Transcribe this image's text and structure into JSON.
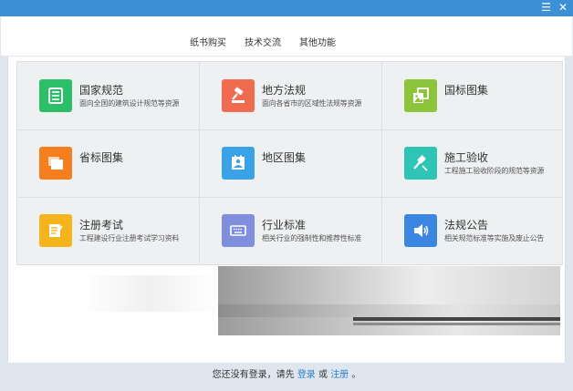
{
  "window": {
    "controls": {
      "menu_icon": "menu-icon",
      "close_icon": "close-icon"
    }
  },
  "topnav": {
    "links": [
      "纸书购买",
      "技术交流",
      "其他功能"
    ]
  },
  "tiles": [
    {
      "title": "国家规范",
      "desc": "面向全国的建筑设计规范等资源",
      "icon": "document-icon",
      "color": "#2bbf6a"
    },
    {
      "title": "地方法规",
      "desc": "面向各省市的区域性法规等资源",
      "icon": "gavel-icon",
      "color": "#f06b4f"
    },
    {
      "title": "国标图集",
      "desc": "",
      "icon": "image-icon",
      "color": "#8cc43c"
    },
    {
      "title": "省标图集",
      "desc": "",
      "icon": "stack-icon",
      "color": "#f57e1f"
    },
    {
      "title": "地区图集",
      "desc": "",
      "icon": "map-photo-icon",
      "color": "#3aa3e8"
    },
    {
      "title": "施工验收",
      "desc": "工程施工验收阶段的规范等资源",
      "icon": "hammer-icon",
      "color": "#2ec4b6"
    },
    {
      "title": "注册考试",
      "desc": "工程建设行业注册考试学习资料",
      "icon": "edit-icon",
      "color": "#f5b41b"
    },
    {
      "title": "行业标准",
      "desc": "相关行业的强制性和推荐性标准",
      "icon": "keyboard-icon",
      "color": "#7f8fdd"
    },
    {
      "title": "法规公告",
      "desc": "相关规范标准等实施及废止公告",
      "icon": "speaker-icon",
      "color": "#3b86e0"
    }
  ],
  "footer": {
    "prefix": "您还没有登录，请先",
    "login": "登录",
    "or": "或",
    "register": "注册",
    "suffix": "。"
  }
}
